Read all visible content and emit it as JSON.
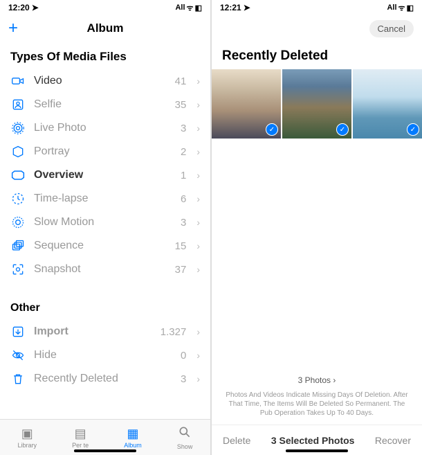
{
  "left": {
    "status": {
      "time": "12:20",
      "signal": "All"
    },
    "nav": {
      "title": "Album"
    },
    "section_types": "Types Of Media Files",
    "rows": [
      {
        "label": "Video",
        "count": "41"
      },
      {
        "label": "Selfie",
        "count": "35"
      },
      {
        "label": "Live Photo",
        "count": "3"
      },
      {
        "label": "Portray",
        "count": "2"
      },
      {
        "label": "Overview",
        "count": "1"
      },
      {
        "label": "Time-lapse",
        "count": "6"
      },
      {
        "label": "Slow Motion",
        "count": "3"
      },
      {
        "label": "Sequence",
        "count": "15"
      },
      {
        "label": "Snapshot",
        "count": "37"
      }
    ],
    "section_other": "Other",
    "other_rows": [
      {
        "label": "Import",
        "count": "1.327"
      },
      {
        "label": "Hide",
        "count": "0"
      },
      {
        "label": "Recently Deleted",
        "count": "3"
      }
    ],
    "tabs": [
      "Library",
      "Per te",
      "Album",
      "Show"
    ]
  },
  "right": {
    "status": {
      "time": "12:21",
      "signal": "All"
    },
    "nav": {
      "cancel": "Cancel"
    },
    "title": "Recently Deleted",
    "photo_count": "3 Photos",
    "disclaimer": "Photos And Videos Indicate Missing Days Of Deletion. After That Time, The Items Will Be Deleted So Permanent. The Pub Operation Takes Up To 40 Days.",
    "toolbar": {
      "delete": "Delete",
      "center": "3 Selected Photos",
      "recover": "Recover"
    }
  }
}
